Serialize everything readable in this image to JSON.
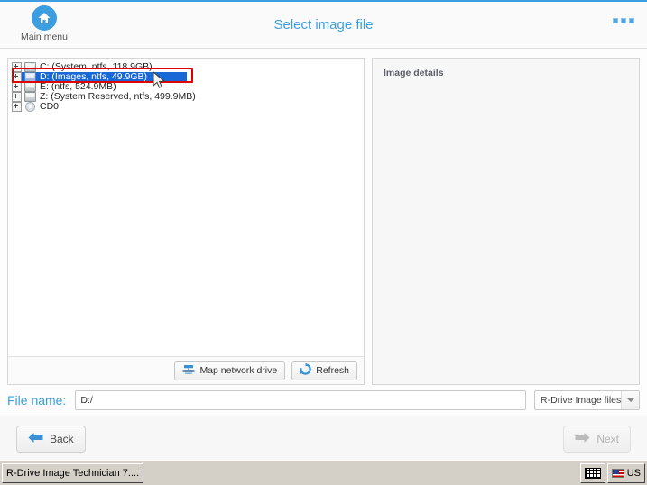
{
  "header": {
    "main_menu_label": "Main menu",
    "home_icon": "home-icon",
    "title": "Select image file",
    "more_icon": "more-options-icon"
  },
  "tree": {
    "items": [
      {
        "label": "C: (System, ntfs, 118.9GB)",
        "icon": "hard-drive-icon",
        "selected": false,
        "expandable": true
      },
      {
        "label": "D: (Images, ntfs, 49.9GB)",
        "icon": "hard-drive-icon",
        "selected": true,
        "expandable": true
      },
      {
        "label": "E: (ntfs, 524.9MB)",
        "icon": "hard-drive-icon",
        "selected": false,
        "expandable": true
      },
      {
        "label": "Z: (System Reserved, ntfs, 499.9MB)",
        "icon": "hard-drive-icon",
        "selected": false,
        "expandable": true
      },
      {
        "label": "CD0",
        "icon": "cd-drive-icon",
        "selected": false,
        "expandable": true
      }
    ]
  },
  "tree_toolbar": {
    "map_network_drive_label": "Map network drive",
    "map_network_drive_icon": "network-drive-icon",
    "refresh_label": "Refresh",
    "refresh_icon": "refresh-icon"
  },
  "details": {
    "title": "Image details"
  },
  "filename": {
    "label": "File name:",
    "value": "D:/",
    "placeholder": "",
    "filetype_value": "R-Drive Image files",
    "filetype_caret_icon": "chevron-down-icon"
  },
  "footer": {
    "back_label": "Back",
    "back_icon": "arrow-left-icon",
    "next_label": "Next",
    "next_icon": "arrow-right-icon"
  },
  "taskbar": {
    "task_label": "R-Drive Image Technician 7....",
    "keyboard_icon": "keyboard-icon",
    "language_label": "US",
    "flag_icon": "us-flag-icon"
  },
  "colors": {
    "accent": "#3c9ee0",
    "selection": "#1868d6",
    "highlight_box": "#e00000",
    "taskbar": "#d4d0c8"
  }
}
